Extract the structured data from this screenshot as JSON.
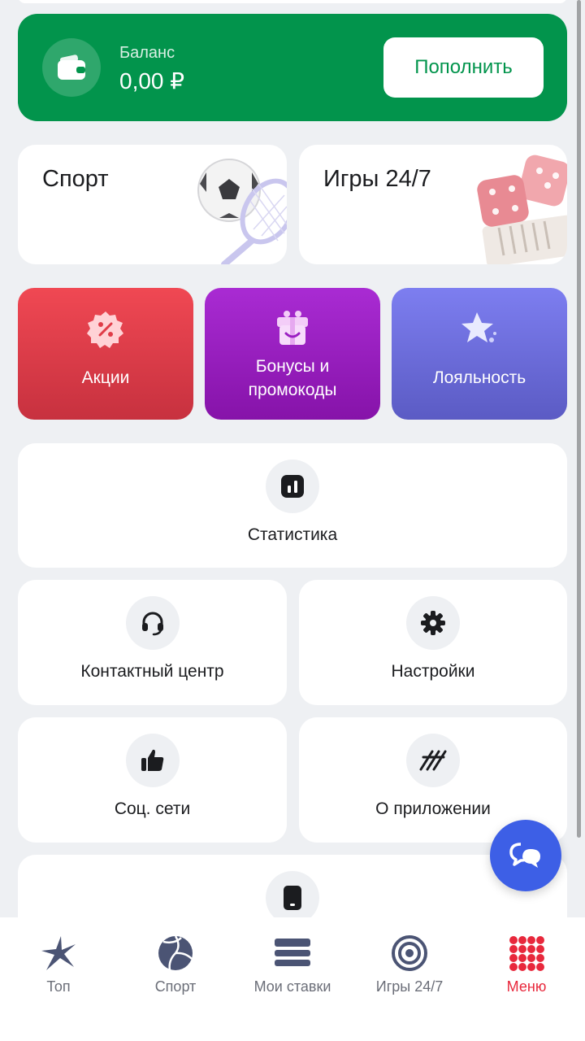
{
  "balance": {
    "label": "Баланс",
    "value": "0,00 ₽",
    "topup_label": "Пополнить",
    "accent": "#02944c",
    "icon": "wallet-icon"
  },
  "categories": [
    {
      "title": "Спорт",
      "icon": "soccer-ball-racket-illustration"
    },
    {
      "title": "Игры 24/7",
      "icon": "dice-backgammon-illustration"
    }
  ],
  "tiles": [
    {
      "label": "Акции",
      "icon": "percent-badge-icon",
      "color": "#e03c48"
    },
    {
      "label": "Бонусы и промокоды",
      "icon": "gift-box-icon",
      "color": "#9a1fc2"
    },
    {
      "label": "Лояльность",
      "icon": "star-icon",
      "color": "#6c6cdc"
    }
  ],
  "menu": {
    "statistics": "Статистика",
    "contact": "Контактный центр",
    "settings": "Настройки",
    "social": "Соц. сети",
    "about": "О приложении"
  },
  "tabbar": {
    "items": [
      {
        "label": "Топ",
        "icon": "star-burst-icon"
      },
      {
        "label": "Спорт",
        "icon": "volleyball-icon"
      },
      {
        "label": "Мои ставки",
        "icon": "stacked-bets-icon"
      },
      {
        "label": "Игры 24/7",
        "icon": "target-icon"
      },
      {
        "label": "Меню",
        "icon": "grid-dots-icon"
      }
    ],
    "active_index": 4,
    "active_color": "#e8283c"
  }
}
